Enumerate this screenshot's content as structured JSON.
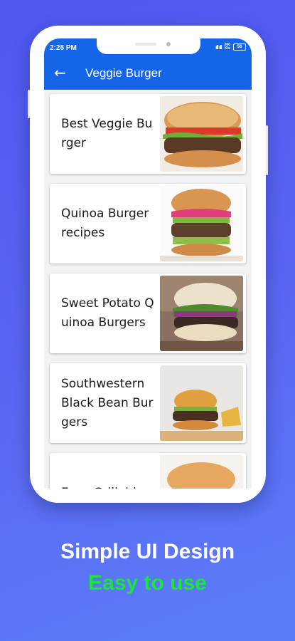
{
  "status_bar": {
    "time": "2:28 PM",
    "signal": "ıll ıll",
    "speed_top": "200",
    "speed_bottom": "K/s",
    "battery": "56"
  },
  "app_bar": {
    "title": "Veggie Burger",
    "back_icon": "arrow-back-icon"
  },
  "recipes": [
    {
      "title": "Best Veggie Burger",
      "image": "burger-photo"
    },
    {
      "title": "Quinoa Burger recipes",
      "image": "burger-photo"
    },
    {
      "title": "Sweet Potato Quinoa Burgers",
      "image": "burger-photo"
    },
    {
      "title": "Southwestern Black Bean Burgers",
      "image": "burger-photo"
    },
    {
      "title": "Easy Grillable",
      "image": "burger-photo"
    }
  ],
  "promo": {
    "headline": "Simple UI Design",
    "subheadline": "Easy to use"
  },
  "colors": {
    "primary": "#1565e8",
    "accent_text": "#19e53a",
    "background": "#5560f0"
  }
}
